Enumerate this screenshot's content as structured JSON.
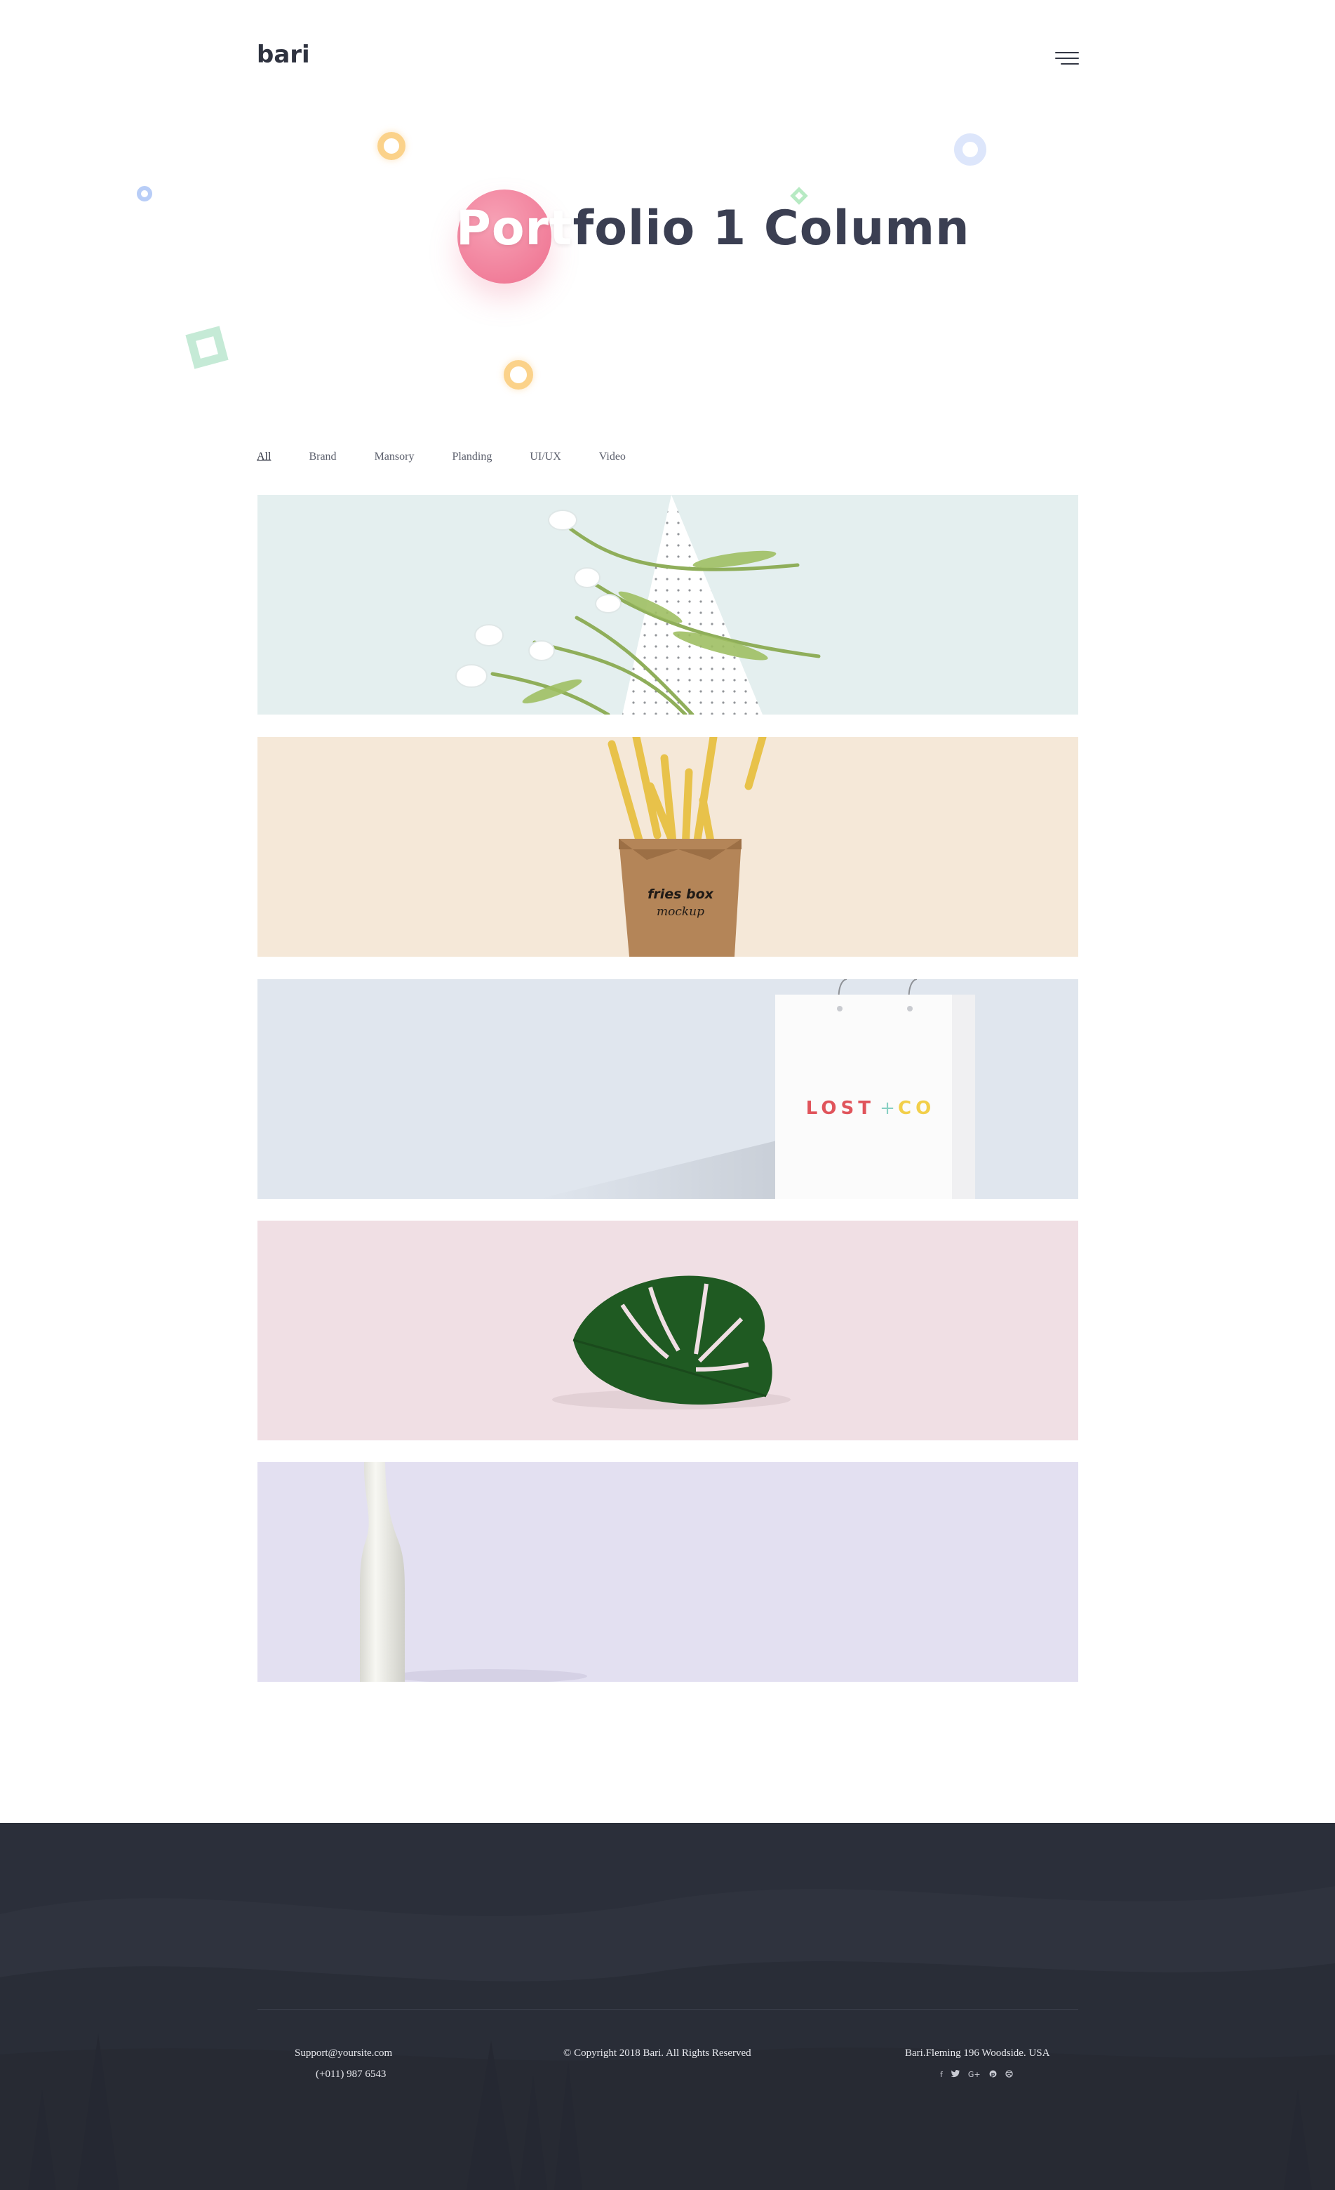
{
  "header": {
    "logo": "bari",
    "menu_icon": "hamburger-menu-icon"
  },
  "hero": {
    "title_highlight": "Port",
    "title_rest": "folio 1 Column"
  },
  "filters": [
    {
      "label": "All",
      "active": true
    },
    {
      "label": "Brand",
      "active": false
    },
    {
      "label": "Mansory",
      "active": false
    },
    {
      "label": "Planding",
      "active": false
    },
    {
      "label": "UI/UX",
      "active": false
    },
    {
      "label": "Video",
      "active": false
    }
  ],
  "portfolio": {
    "items": [
      {
        "name": "tulips-mockup",
        "background": "#e4efef"
      },
      {
        "name": "fries-box-mockup",
        "background": "#f5e8d8",
        "print_line1": "fries box",
        "print_line2": "mockup"
      },
      {
        "name": "shopping-bag-mockup",
        "background": "#e0e6ee",
        "brand_left": "LOST",
        "brand_plus": "+",
        "brand_right": "CO"
      },
      {
        "name": "monstera-leaf",
        "background": "#f0dfe4"
      },
      {
        "name": "bottle-mockup",
        "background": "#e3e0f1"
      }
    ]
  },
  "footer": {
    "email": "Support@yoursite.com",
    "phone": "(+011) 987 6543",
    "copyright": "© Copyright 2018 Bari. All Rights Reserved",
    "address": "Bari.Fleming 196 Woodside. USA",
    "social_icons": [
      "f",
      "t",
      "G+",
      "p",
      "d"
    ],
    "background": "#2b2f3a"
  },
  "colors": {
    "accent_pink": "#ee6f8e",
    "accent_green": "#7ed957",
    "text_dark": "#3b3f52"
  }
}
